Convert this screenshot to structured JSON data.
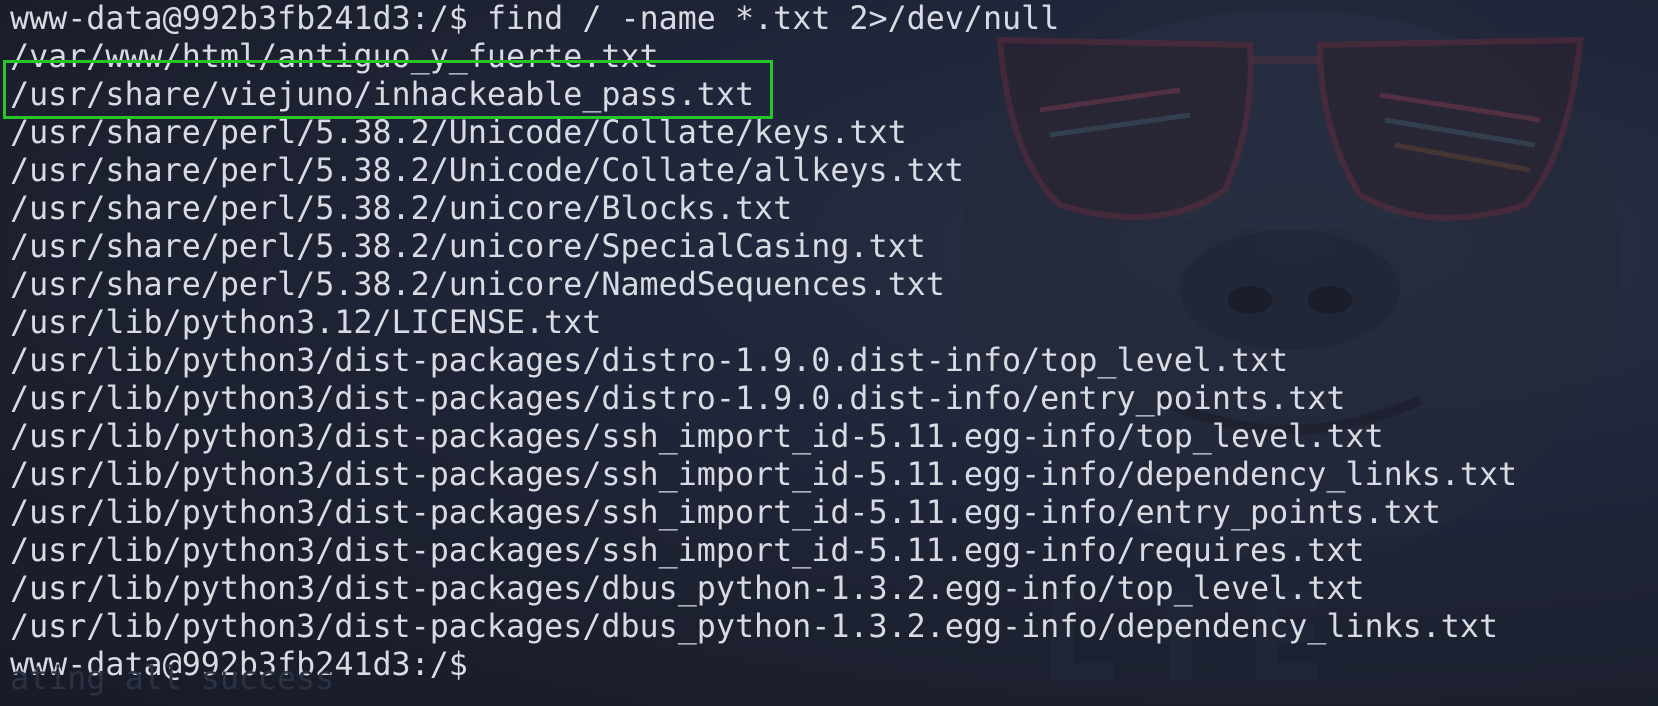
{
  "terminal": {
    "prompt": "www-data@992b3fb241d3:/$",
    "command": "find / -name *.txt 2>/dev/null",
    "output_lines": [
      "/var/www/html/antiguo_y_fuerte.txt",
      "/usr/share/viejuno/inhackeable_pass.txt",
      "/usr/share/perl/5.38.2/Unicode/Collate/keys.txt",
      "/usr/share/perl/5.38.2/Unicode/Collate/allkeys.txt",
      "/usr/share/perl/5.38.2/unicore/Blocks.txt",
      "/usr/share/perl/5.38.2/unicore/SpecialCasing.txt",
      "/usr/share/perl/5.38.2/unicore/NamedSequences.txt",
      "/usr/lib/python3.12/LICENSE.txt",
      "/usr/lib/python3/dist-packages/distro-1.9.0.dist-info/top_level.txt",
      "/usr/lib/python3/dist-packages/distro-1.9.0.dist-info/entry_points.txt",
      "/usr/lib/python3/dist-packages/ssh_import_id-5.11.egg-info/top_level.txt",
      "/usr/lib/python3/dist-packages/ssh_import_id-5.11.egg-info/dependency_links.txt",
      "/usr/lib/python3/dist-packages/ssh_import_id-5.11.egg-info/entry_points.txt",
      "/usr/lib/python3/dist-packages/ssh_import_id-5.11.egg-info/requires.txt",
      "/usr/lib/python3/dist-packages/dbus_python-1.3.2.egg-info/top_level.txt",
      "/usr/lib/python3/dist-packages/dbus_python-1.3.2.egg-info/dependency_links.txt"
    ],
    "final_prompt": "www-data@992b3fb241d3:/$",
    "ghost_text": "ating all success"
  },
  "colors": {
    "text": "#d8dbe2",
    "highlight_border": "#27c42a",
    "background": "#1d2130"
  },
  "icons": {
    "wallpaper": "gorilla-with-sunglasses-wallpaper"
  }
}
